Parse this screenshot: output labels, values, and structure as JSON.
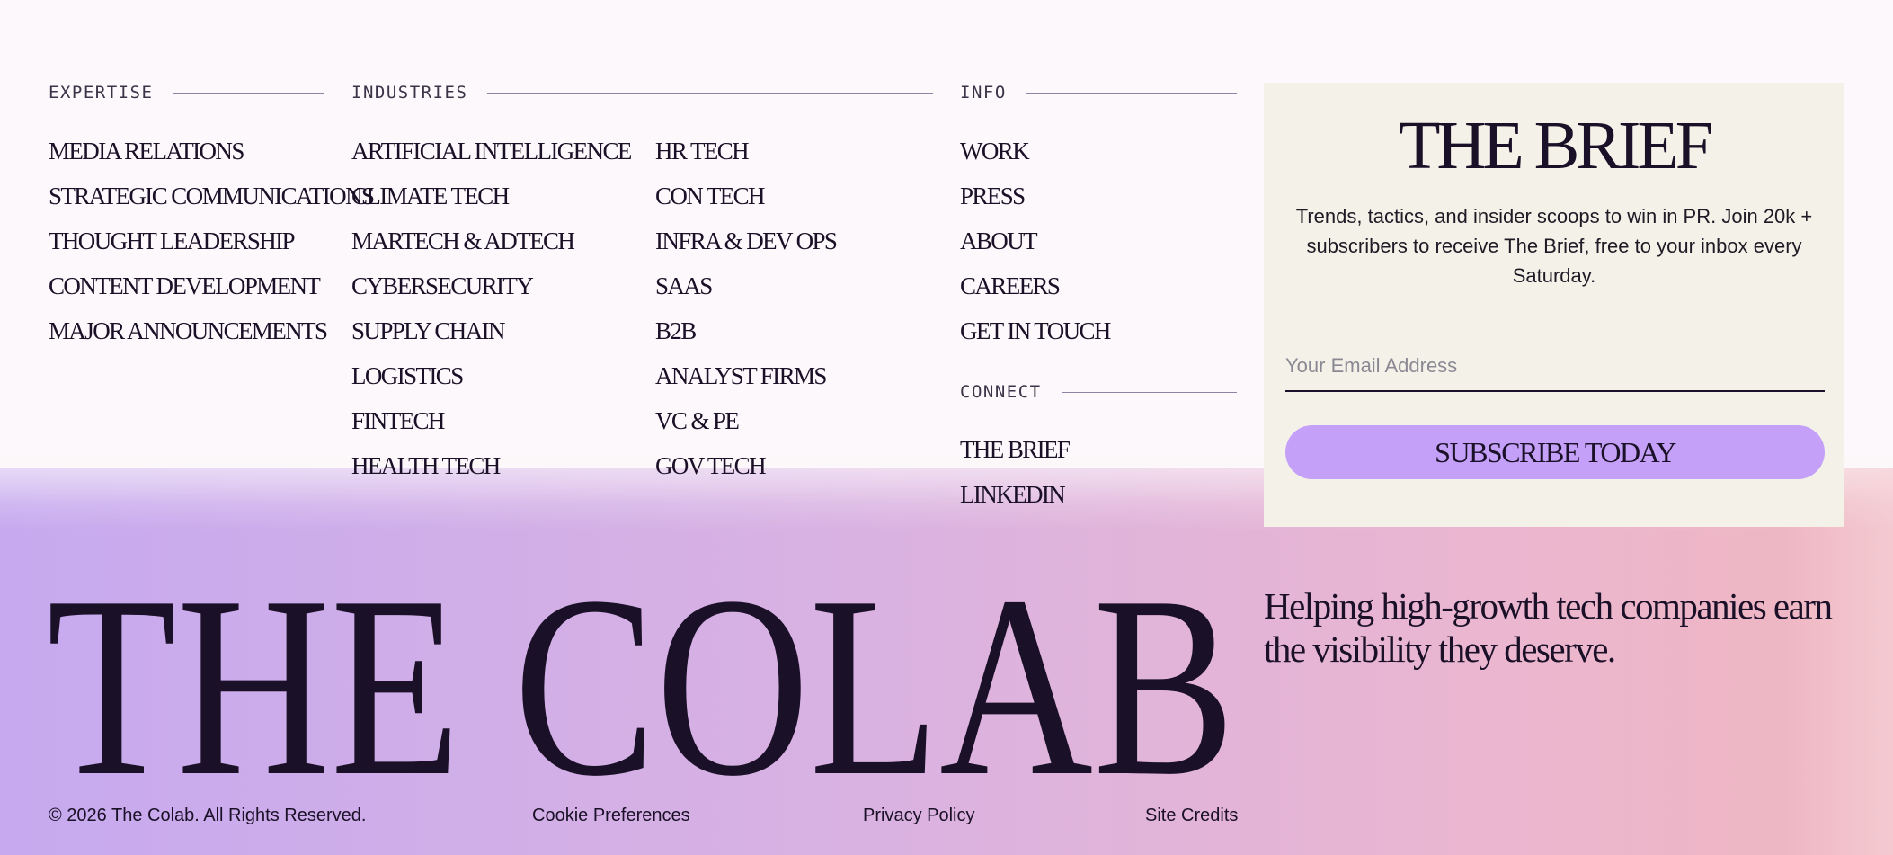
{
  "columns": {
    "expertise": {
      "heading": "EXPERTISE",
      "items": [
        "MEDIA RELATIONS",
        "STRATEGIC COMMUNICATIONS",
        "THOUGHT LEADERSHIP",
        "CONTENT DEVELOPMENT",
        "MAJOR ANNOUNCEMENTS"
      ]
    },
    "industries": {
      "heading": "INDUSTRIES",
      "items_col1": [
        "ARTIFICIAL INTELLIGENCE",
        "CLIMATE TECH",
        "MARTECH & ADTECH",
        "CYBERSECURITY",
        "SUPPLY CHAIN",
        "LOGISTICS",
        "FINTECH",
        "HEALTH TECH"
      ],
      "items_col2": [
        "HR TECH",
        "CON TECH",
        "INFRA & DEV OPS",
        "SAAS",
        "B2B",
        "ANALYST FIRMS",
        "VC & PE",
        "GOV TECH"
      ]
    },
    "info": {
      "heading": "INFO",
      "items": [
        "WORK",
        "PRESS",
        "ABOUT",
        "CAREERS",
        "GET IN TOUCH"
      ]
    },
    "connect": {
      "heading": "CONNECT",
      "items": [
        "THE BRIEF",
        "LINKEDIN"
      ]
    }
  },
  "newsletter": {
    "title": "THE BRIEF",
    "description": "Trends, tactics, and insider scoops to win in PR. Join 20k + subscribers to receive The Brief, free to your inbox every Saturday.",
    "email_placeholder": "Your Email Address",
    "email_value": "",
    "button_label": "SUBSCRIBE TODAY"
  },
  "brand": {
    "wordmark": "THE COLAB",
    "tagline": "Helping high-growth tech companies earn the visibility they deserve."
  },
  "footer": {
    "copyright": "© 2026 The Colab. All Rights Reserved.",
    "cookie_label": "Cookie Preferences",
    "privacy_label": "Privacy Policy",
    "credits_label": "Site Credits"
  },
  "colors": {
    "ink": "#1a1027",
    "background": "#fcf8fb",
    "brief_panel": "#f4f2e8",
    "button": "#c4a0f8",
    "gradient_left": "#c6a9ef",
    "gradient_right": "#f0b7bf"
  }
}
